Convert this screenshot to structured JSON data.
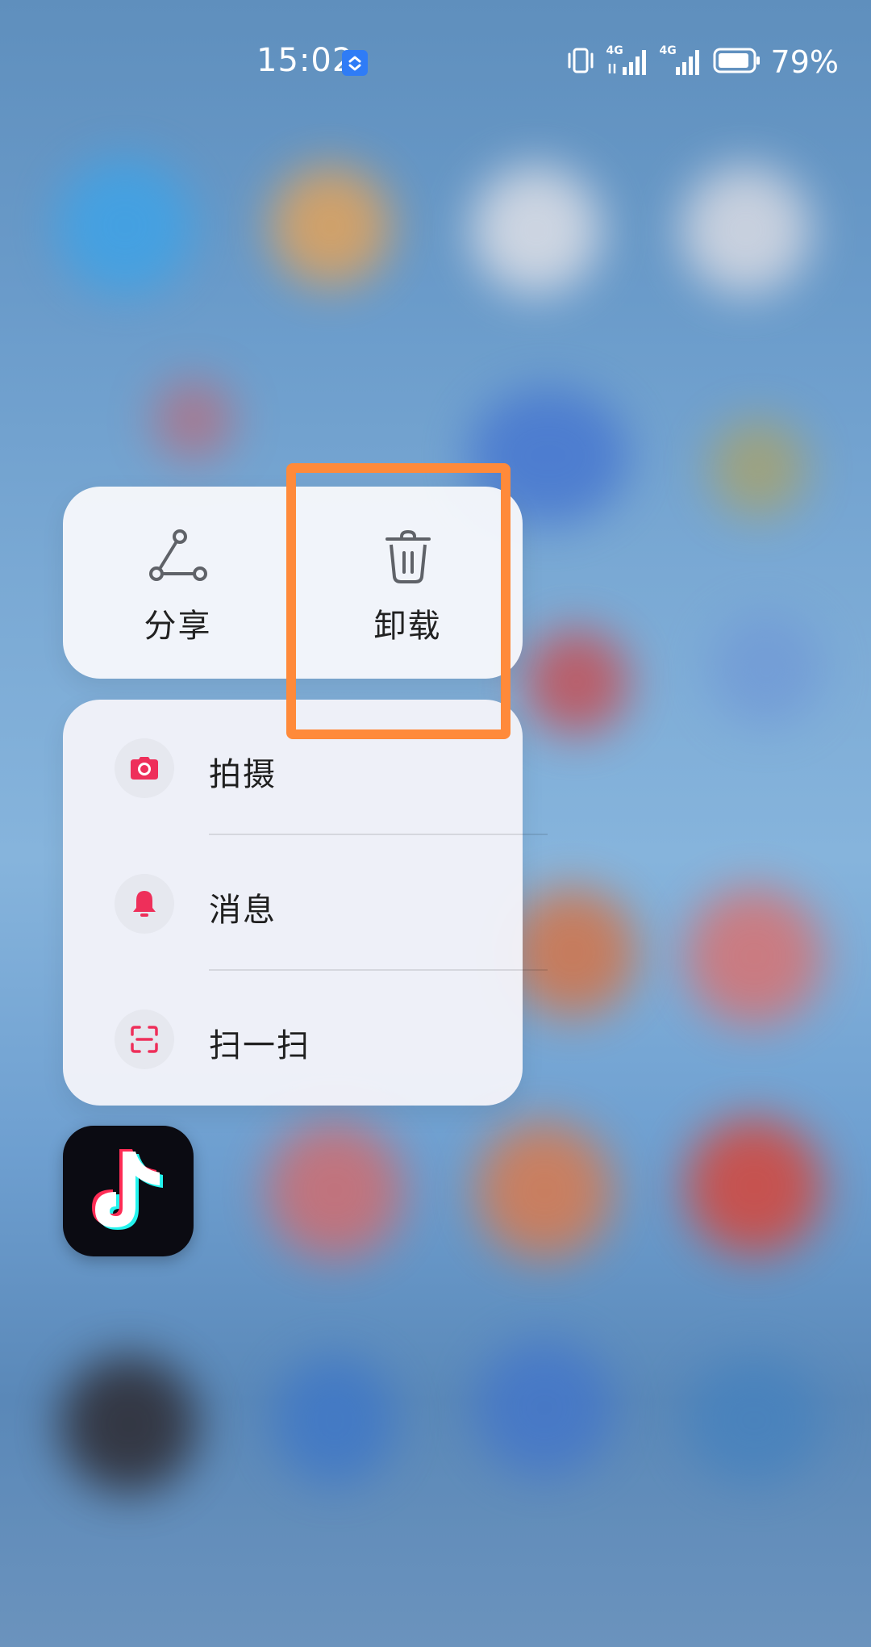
{
  "status_bar": {
    "time": "15:02",
    "battery_percent": "79%",
    "network_labels": [
      "4G",
      "4G"
    ]
  },
  "context_menu": {
    "top_actions": [
      {
        "label": "分享",
        "icon": "share-icon"
      },
      {
        "label": "卸载",
        "icon": "trash-icon"
      }
    ],
    "shortcuts": [
      {
        "label": "拍摄",
        "icon": "camera-icon"
      },
      {
        "label": "消息",
        "icon": "bell-icon"
      },
      {
        "label": "扫一扫",
        "icon": "scan-icon"
      }
    ]
  },
  "colors": {
    "accent_red": "#ee2f5a",
    "highlight_orange": "#ff8a3a",
    "icon_gray": "#5f6268"
  }
}
